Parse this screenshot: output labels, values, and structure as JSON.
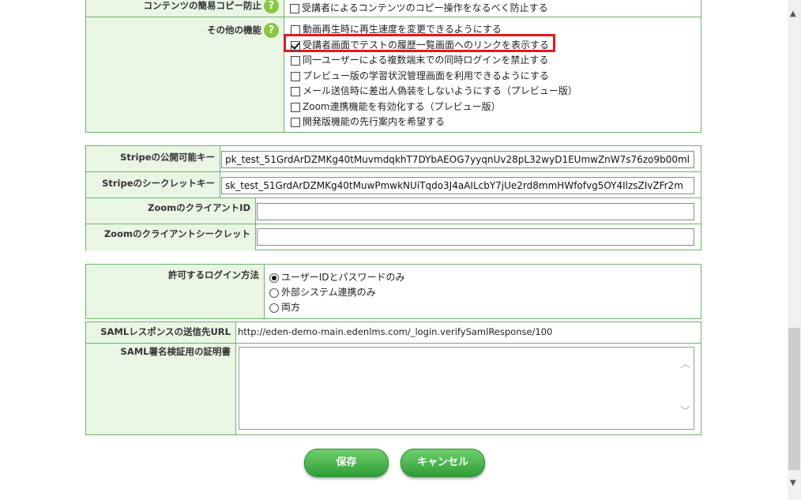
{
  "features": {
    "prev_label": "コンテンツの簡易コピー防止",
    "prev_option": "受講者によるコンテンツのコピー操作をなるべく防止する",
    "other_label": "その他の機能",
    "help_glyph": "?",
    "options": [
      {
        "label": "動画再生時に再生速度を変更できるようにする",
        "checked": false
      },
      {
        "label": "受講者画面でテストの履歴一覧画面へのリンクを表示する",
        "checked": true
      },
      {
        "label": "同一ユーザーによる複数端末での同時ログインを禁止する",
        "checked": false
      },
      {
        "label": "プレビュー版の学習状況管理画面を利用できるようにする",
        "checked": false
      },
      {
        "label": "メール送信時に差出人偽装をしないようにする（プレビュー版）",
        "checked": false
      },
      {
        "label": "Zoom連携機能を有効化する（プレビュー版）",
        "checked": false
      },
      {
        "label": "開発版機能の先行案内を希望する",
        "checked": false
      }
    ]
  },
  "keys": {
    "stripe_public_label": "Stripeの公開可能キー",
    "stripe_public_value": "pk_test_51GrdArDZMKg40tMuvmdqkhT7DYbAEOG7yyqnUv28pL32wyD1EUmwZnW7s76zo9b00ml",
    "stripe_secret_label": "Stripeのシークレットキー",
    "stripe_secret_value": "sk_test_51GrdArDZMKg40tMuwPmwkNUiTqdo3J4aAILcbY7jUe2rd8mmHWfofvg5OY4IlzsZIvZFr2m",
    "zoom_client_id_label": "ZoomのクライアントID",
    "zoom_client_id_value": "",
    "zoom_client_secret_label": "Zoomのクライアントシークレット",
    "zoom_client_secret_value": ""
  },
  "login": {
    "label": "許可するログイン方法",
    "options": [
      {
        "label": "ユーザーIDとパスワードのみ",
        "selected": true
      },
      {
        "label": "外部システム連携のみ",
        "selected": false
      },
      {
        "label": "両方",
        "selected": false
      }
    ]
  },
  "saml": {
    "response_label": "SAMLレスポンスの送信先URL",
    "response_url": "http://eden-demo-main.edenlms.com/_login.verifySamlResponse/100",
    "cert_label": "SAML署名検証用の証明書",
    "cert_value": ""
  },
  "buttons": {
    "save": "保存",
    "cancel": "キャンセル"
  },
  "scroll": {
    "up_arrow": "▲",
    "down_arrow": "▼",
    "textarea_up": "︿",
    "textarea_down": "﹀"
  },
  "colors": {
    "label_bg": "#e9f6e4",
    "border": "#6cb36c",
    "highlight": "#e8161b",
    "button": "#3aa83f"
  }
}
